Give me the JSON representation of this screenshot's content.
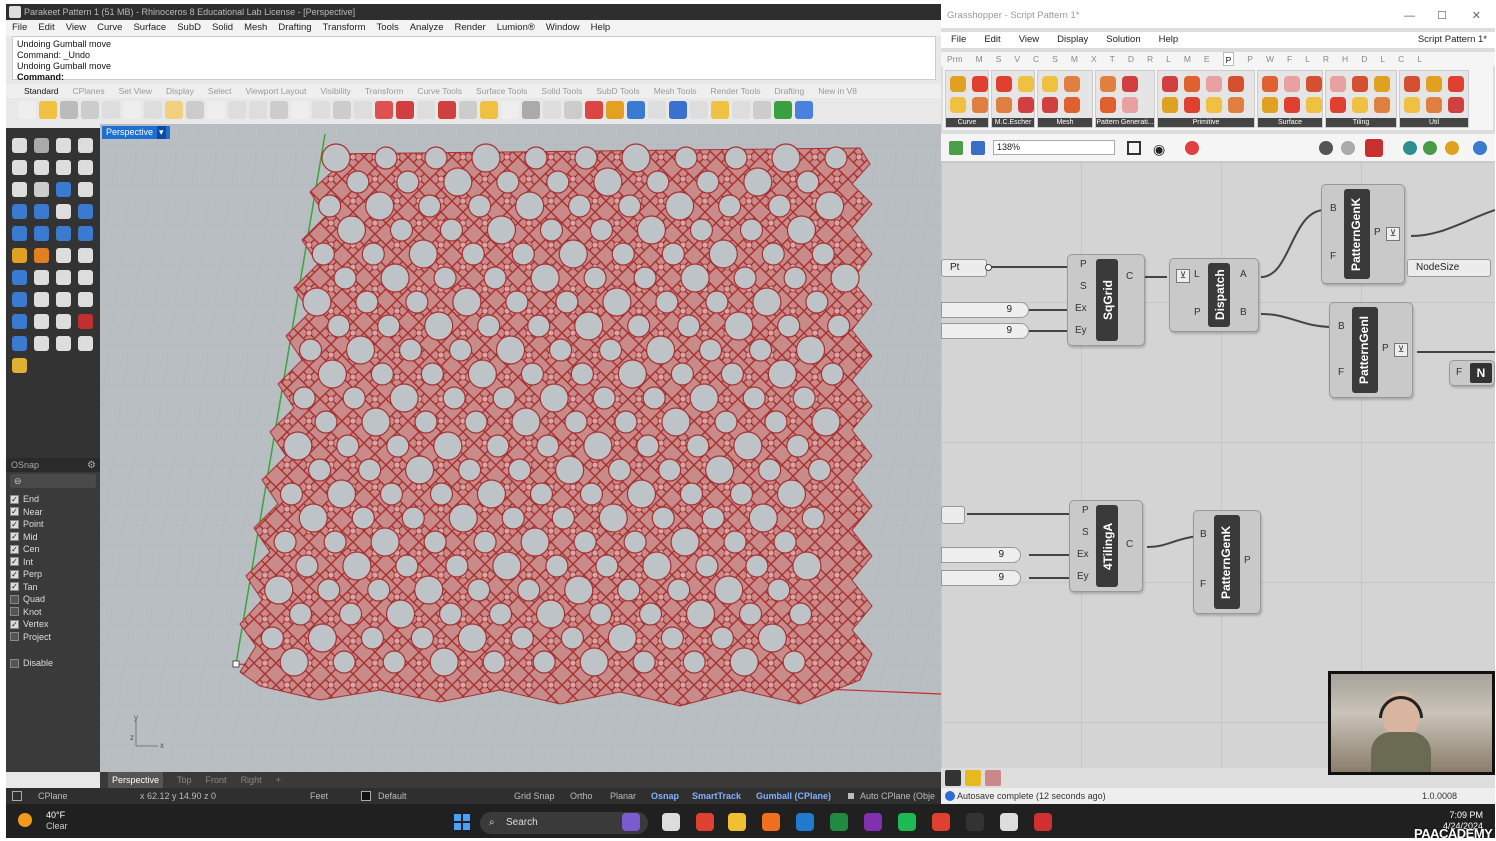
{
  "rhino": {
    "title": "Parakeet Pattern 1 (51 MB) - Rhinoceros 8 Educational Lab License - [Perspective]",
    "menu": [
      "File",
      "Edit",
      "View",
      "Curve",
      "Surface",
      "SubD",
      "Solid",
      "Mesh",
      "Drafting",
      "Transform",
      "Tools",
      "Analyze",
      "Render",
      "Lumion®",
      "Window",
      "Help"
    ],
    "command_history": [
      "Undoing Gumball move",
      "Command: _Undo",
      "Undoing Gumball move"
    ],
    "command_prompt": "Command:",
    "toolbar_tabs": [
      "Standard",
      "CPlanes",
      "Set View",
      "Display",
      "Select",
      "Viewport Layout",
      "Visibility",
      "Transform",
      "Curve Tools",
      "Surface Tools",
      "Solid Tools",
      "SubD Tools",
      "Mesh Tools",
      "Render Tools",
      "Drafting",
      "New in V8"
    ],
    "viewport_title": "Perspective",
    "viewport_tabs": [
      "Perspective",
      "Top",
      "Front",
      "Right",
      "+"
    ],
    "osnap": {
      "header": "OSnap",
      "items": [
        {
          "label": "End",
          "checked": true
        },
        {
          "label": "Near",
          "checked": true
        },
        {
          "label": "Point",
          "checked": true
        },
        {
          "label": "Mid",
          "checked": true
        },
        {
          "label": "Cen",
          "checked": true
        },
        {
          "label": "Int",
          "checked": true
        },
        {
          "label": "Perp",
          "checked": true
        },
        {
          "label": "Tan",
          "checked": true
        },
        {
          "label": "Quad",
          "checked": false
        },
        {
          "label": "Knot",
          "checked": false
        },
        {
          "label": "Vertex",
          "checked": true
        },
        {
          "label": "Project",
          "checked": false
        }
      ],
      "disable": "Disable"
    },
    "status": {
      "cplane": "CPlane",
      "coords": "x 62.12  y 14.90  z 0",
      "units": "Feet",
      "layer": "Default",
      "grid_snap": "Grid Snap",
      "ortho": "Ortho",
      "planar": "Planar",
      "osnap": "Osnap",
      "smarttrack": "SmartTrack",
      "gumball": "Gumball (CPlane)",
      "auto_cplane": "Auto CPlane (Obje"
    },
    "pattern_color": "#b84848"
  },
  "gh": {
    "title": "Grasshopper - Script Pattern 1*",
    "menu": [
      "File",
      "Edit",
      "View",
      "Display",
      "Solution",
      "Help"
    ],
    "doc_name": "Script Pattern 1*",
    "tabs": [
      "Prm",
      "M",
      "S",
      "V",
      "C",
      "S",
      "M",
      "X",
      "T",
      "D",
      "R",
      "L",
      "M",
      "E",
      "P",
      "P",
      "W",
      "F",
      "L",
      "R",
      "H",
      "D",
      "L",
      "C",
      "L"
    ],
    "selected_tab_index": 14,
    "groups": [
      "Curve",
      "M.C.Escher",
      "Mesh",
      "Pattern Generati...",
      "Primitive",
      "Surface",
      "Tiling",
      "Util"
    ],
    "zoom": "138%",
    "nodes": {
      "sqgrid": {
        "name": "SqGrid",
        "inputs": [
          "P",
          "S",
          "Ex",
          "Ey"
        ],
        "output": "C"
      },
      "dispatch": {
        "name": "Dispatch",
        "inputs": [
          "L",
          "P"
        ],
        "outputs": [
          "A",
          "B"
        ]
      },
      "patterngen1": {
        "name": "PatternGenK",
        "inputs": [
          "B",
          "F"
        ],
        "output": "P"
      },
      "patterngen2": {
        "name": "PatternGenI",
        "inputs": [
          "B",
          "F"
        ],
        "output": "P"
      },
      "tiling": {
        "name": "4TilingA",
        "inputs": [
          "P",
          "S",
          "Ex",
          "Ey"
        ],
        "output": "C"
      },
      "patterngen3": {
        "name": "PatternGenK",
        "inputs": [
          "B",
          "F"
        ],
        "output": "P"
      }
    },
    "pt_panel": "Pt",
    "nodesize_panel": "NodeSize",
    "n_node": "N",
    "f_port": "F",
    "sliders": [
      "9",
      "9",
      "9",
      "9"
    ],
    "status": "Autosave complete (12 seconds ago)",
    "version": "1.0.0008"
  },
  "taskbar": {
    "temp": "40°F",
    "weather": "Clear",
    "search": "Search",
    "time": "7:09 PM",
    "date": "4/24/2024",
    "brand": "PAACADEMY"
  }
}
